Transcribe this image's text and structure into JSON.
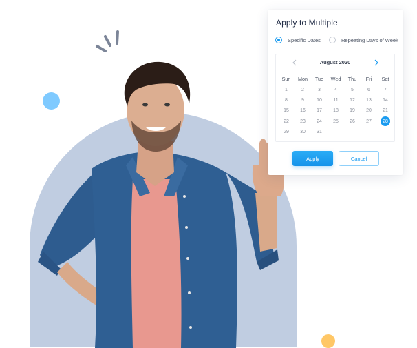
{
  "dialog": {
    "title": "Apply to Multiple",
    "options": [
      {
        "label": "Specific Dates",
        "checked": true
      },
      {
        "label": "Repeating Days of Week",
        "checked": false
      }
    ],
    "calendar": {
      "month_label": "August  2020",
      "prev_icon": "chevron-left-icon",
      "next_icon": "chevron-right-icon",
      "weekdays": [
        "Sun",
        "Mon",
        "Tue",
        "Wed",
        "Thu",
        "Fri",
        "Sat"
      ],
      "weeks": [
        [
          "1",
          "2",
          "3",
          "4",
          "5",
          "6",
          "7"
        ],
        [
          "8",
          "9",
          "10",
          "11",
          "12",
          "13",
          "14"
        ],
        [
          "15",
          "16",
          "17",
          "18",
          "19",
          "20",
          "21"
        ],
        [
          "22",
          "23",
          "24",
          "25",
          "26",
          "27",
          "28"
        ],
        [
          "29",
          "30",
          "31",
          "",
          "",
          "",
          ""
        ]
      ],
      "selected_day": "28"
    },
    "apply_label": "Apply",
    "cancel_label": "Cancel"
  },
  "colors": {
    "accent": "#1a9bf0",
    "arch_background": "#c0cde1",
    "dot_blue": "#7fcaff",
    "dot_orange": "#ffc766",
    "spark": "#7c8598"
  },
  "illustration": {
    "subject": "smiling man in denim shirt and pink t-shirt pointing up at calendar"
  }
}
